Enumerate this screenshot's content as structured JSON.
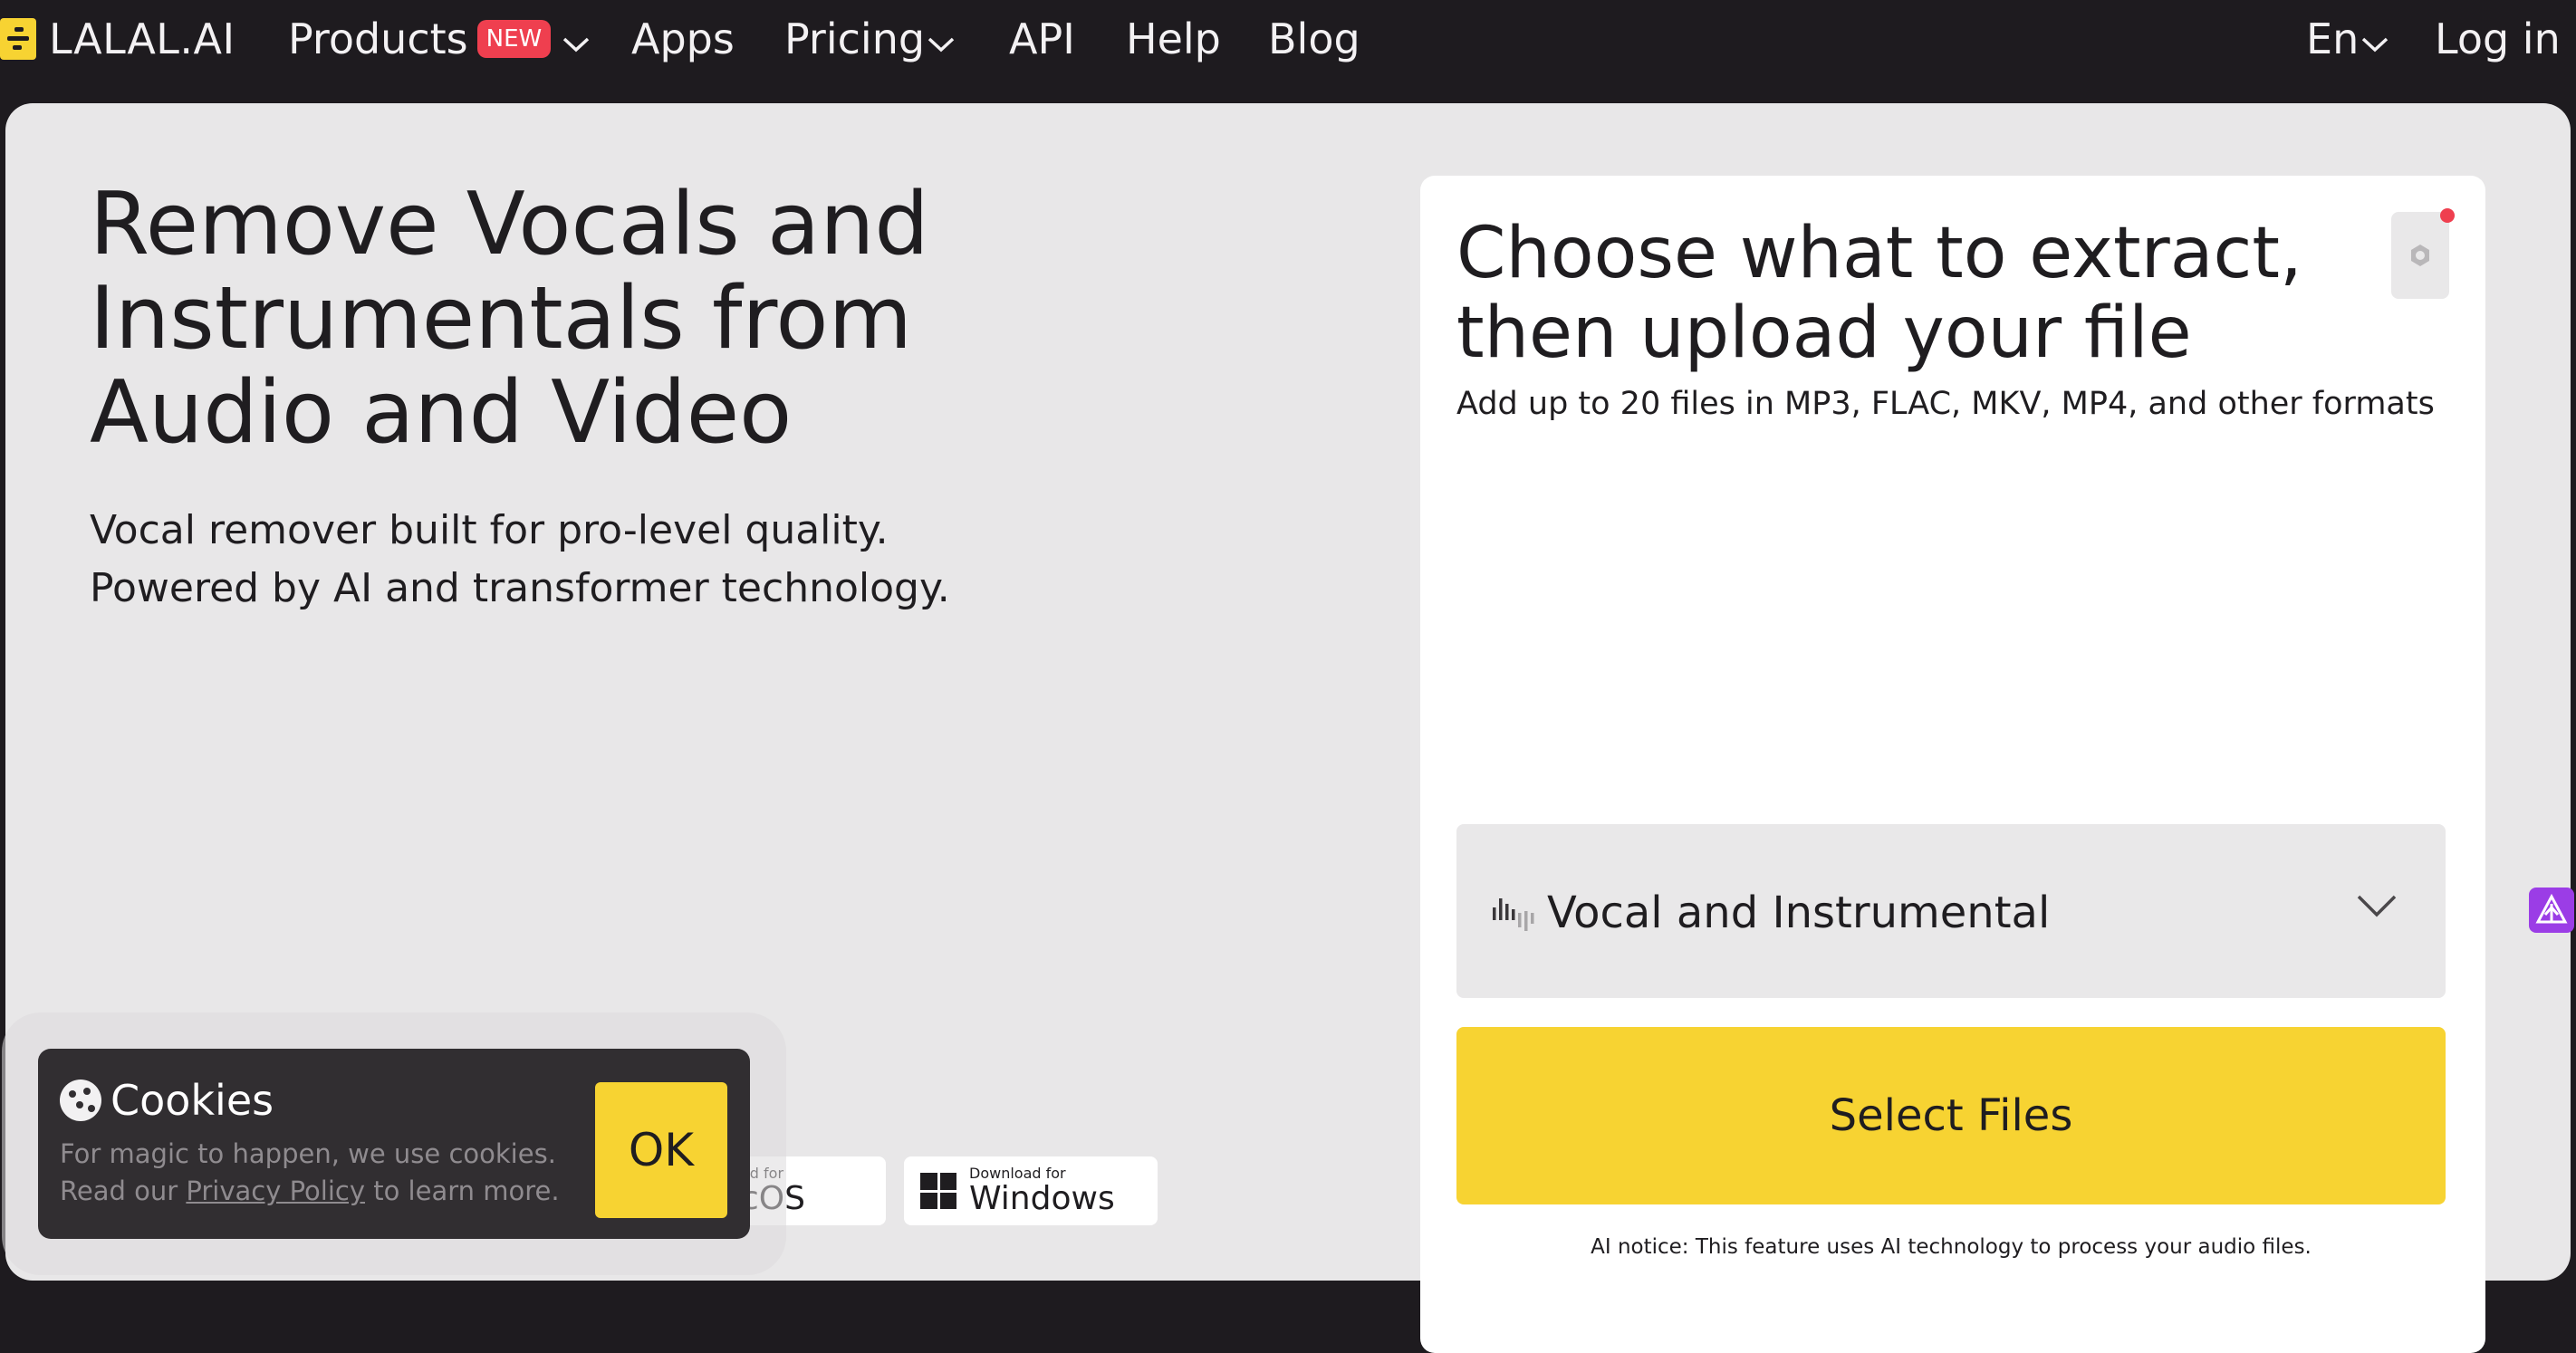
{
  "nav": {
    "logo_text": "LALAL.AI",
    "products": "Products",
    "new_badge": "NEW",
    "apps": "Apps",
    "pricing": "Pricing",
    "api": "API",
    "help": "Help",
    "blog": "Blog",
    "language": "En",
    "login": "Log in"
  },
  "hero": {
    "title": "Remove Vocals and Instrumentals from Audio and Video",
    "subtitle_line1": "Vocal remover built for pro-level quality.",
    "subtitle_line2": "Powered by AI and transformer technology."
  },
  "downloads": {
    "mac_small": "ad for",
    "mac_big": "cOS",
    "windows_small": "Download for",
    "windows_big": "Windows"
  },
  "cookies": {
    "title": "Cookies",
    "text_before": "For magic to happen, we use cookies. Read our ",
    "link": "Privacy Policy",
    "text_after": " to learn more.",
    "ok": "OK"
  },
  "extract": {
    "title_line1": "Choose what to extract,",
    "title_line2": "then upload your file",
    "subtitle": "Add up to 20 files in MP3, FLAC, MKV, MP4, and other formats",
    "stem_selected": "Vocal and Instrumental",
    "select_files": "Select Files",
    "ai_notice": "AI notice: This feature uses AI technology to process your audio files."
  },
  "colors": {
    "nav_bg": "#1e1b1f",
    "panel_bg": "#e8e7e8",
    "accent_yellow": "#f7d332",
    "badge_red": "#ef3f4f",
    "ai_badge_purple": "#9b3de6"
  },
  "icons": [
    "logo-icon",
    "chevron-down-icon",
    "cookie-icon",
    "windows-icon",
    "settings-icon",
    "waveform-icon",
    "ai-badge-icon"
  ]
}
